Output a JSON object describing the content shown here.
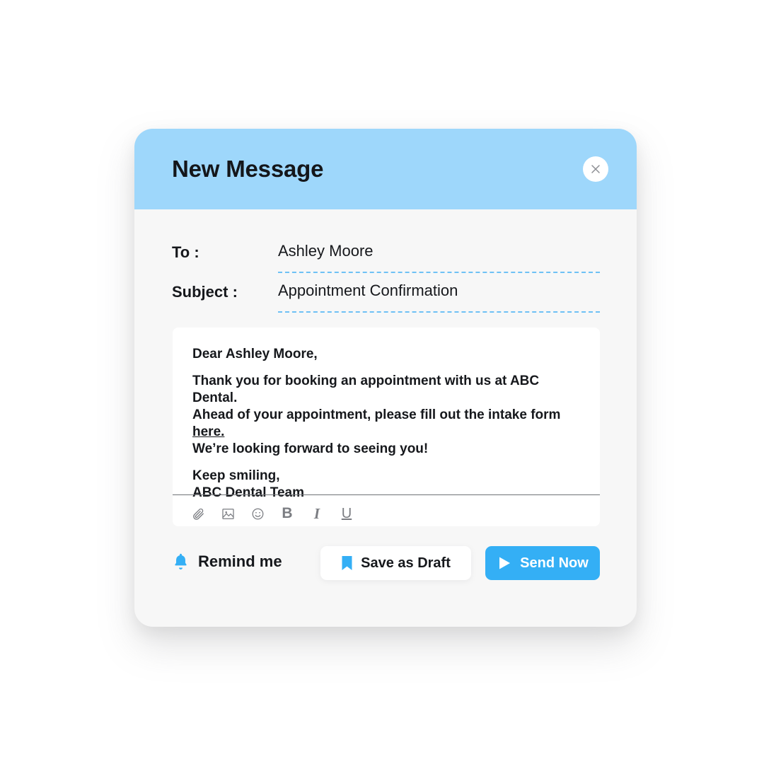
{
  "header": {
    "title": "New Message",
    "close_icon": "close-icon",
    "background_color": "#9ED7FB"
  },
  "fields": [
    {
      "label": "To :",
      "value": "Ashley Moore"
    },
    {
      "label": "Subject :",
      "value": "Appointment Confirmation"
    }
  ],
  "body": {
    "greeting": "Dear Ashley Moore,",
    "line1": "Thank you for booking an appointment with us at ABC Dental.",
    "line2_before_link": "Ahead of your appointment, please fill out the intake form ",
    "link_text": "here.",
    "line3": "We’re looking forward to seeing you!",
    "signoff": "Keep smiling,",
    "signature": "ABC Dental Team"
  },
  "toolbar": {
    "items": [
      {
        "name": "attachment-icon",
        "glyph": ""
      },
      {
        "name": "image-icon",
        "glyph": ""
      },
      {
        "name": "emoji-icon",
        "glyph": ""
      },
      {
        "name": "bold-icon",
        "glyph": "B"
      },
      {
        "name": "italic-icon",
        "glyph": "I"
      },
      {
        "name": "underline-icon",
        "glyph": "U"
      }
    ]
  },
  "footer": {
    "remind_label": "Remind me",
    "remind_icon": "bell-icon",
    "draft_label": "Save as Draft",
    "draft_icon": "bookmark-icon",
    "send_label": "Send Now",
    "send_icon": "play-icon"
  },
  "colors": {
    "accent_blue": "#34AFF5",
    "header_blue": "#9ED7FB",
    "dash_blue": "#6EC1F5",
    "card_bg": "#F7F7F7",
    "text": "#16181C",
    "toolbar_gray": "#7B7D82"
  }
}
